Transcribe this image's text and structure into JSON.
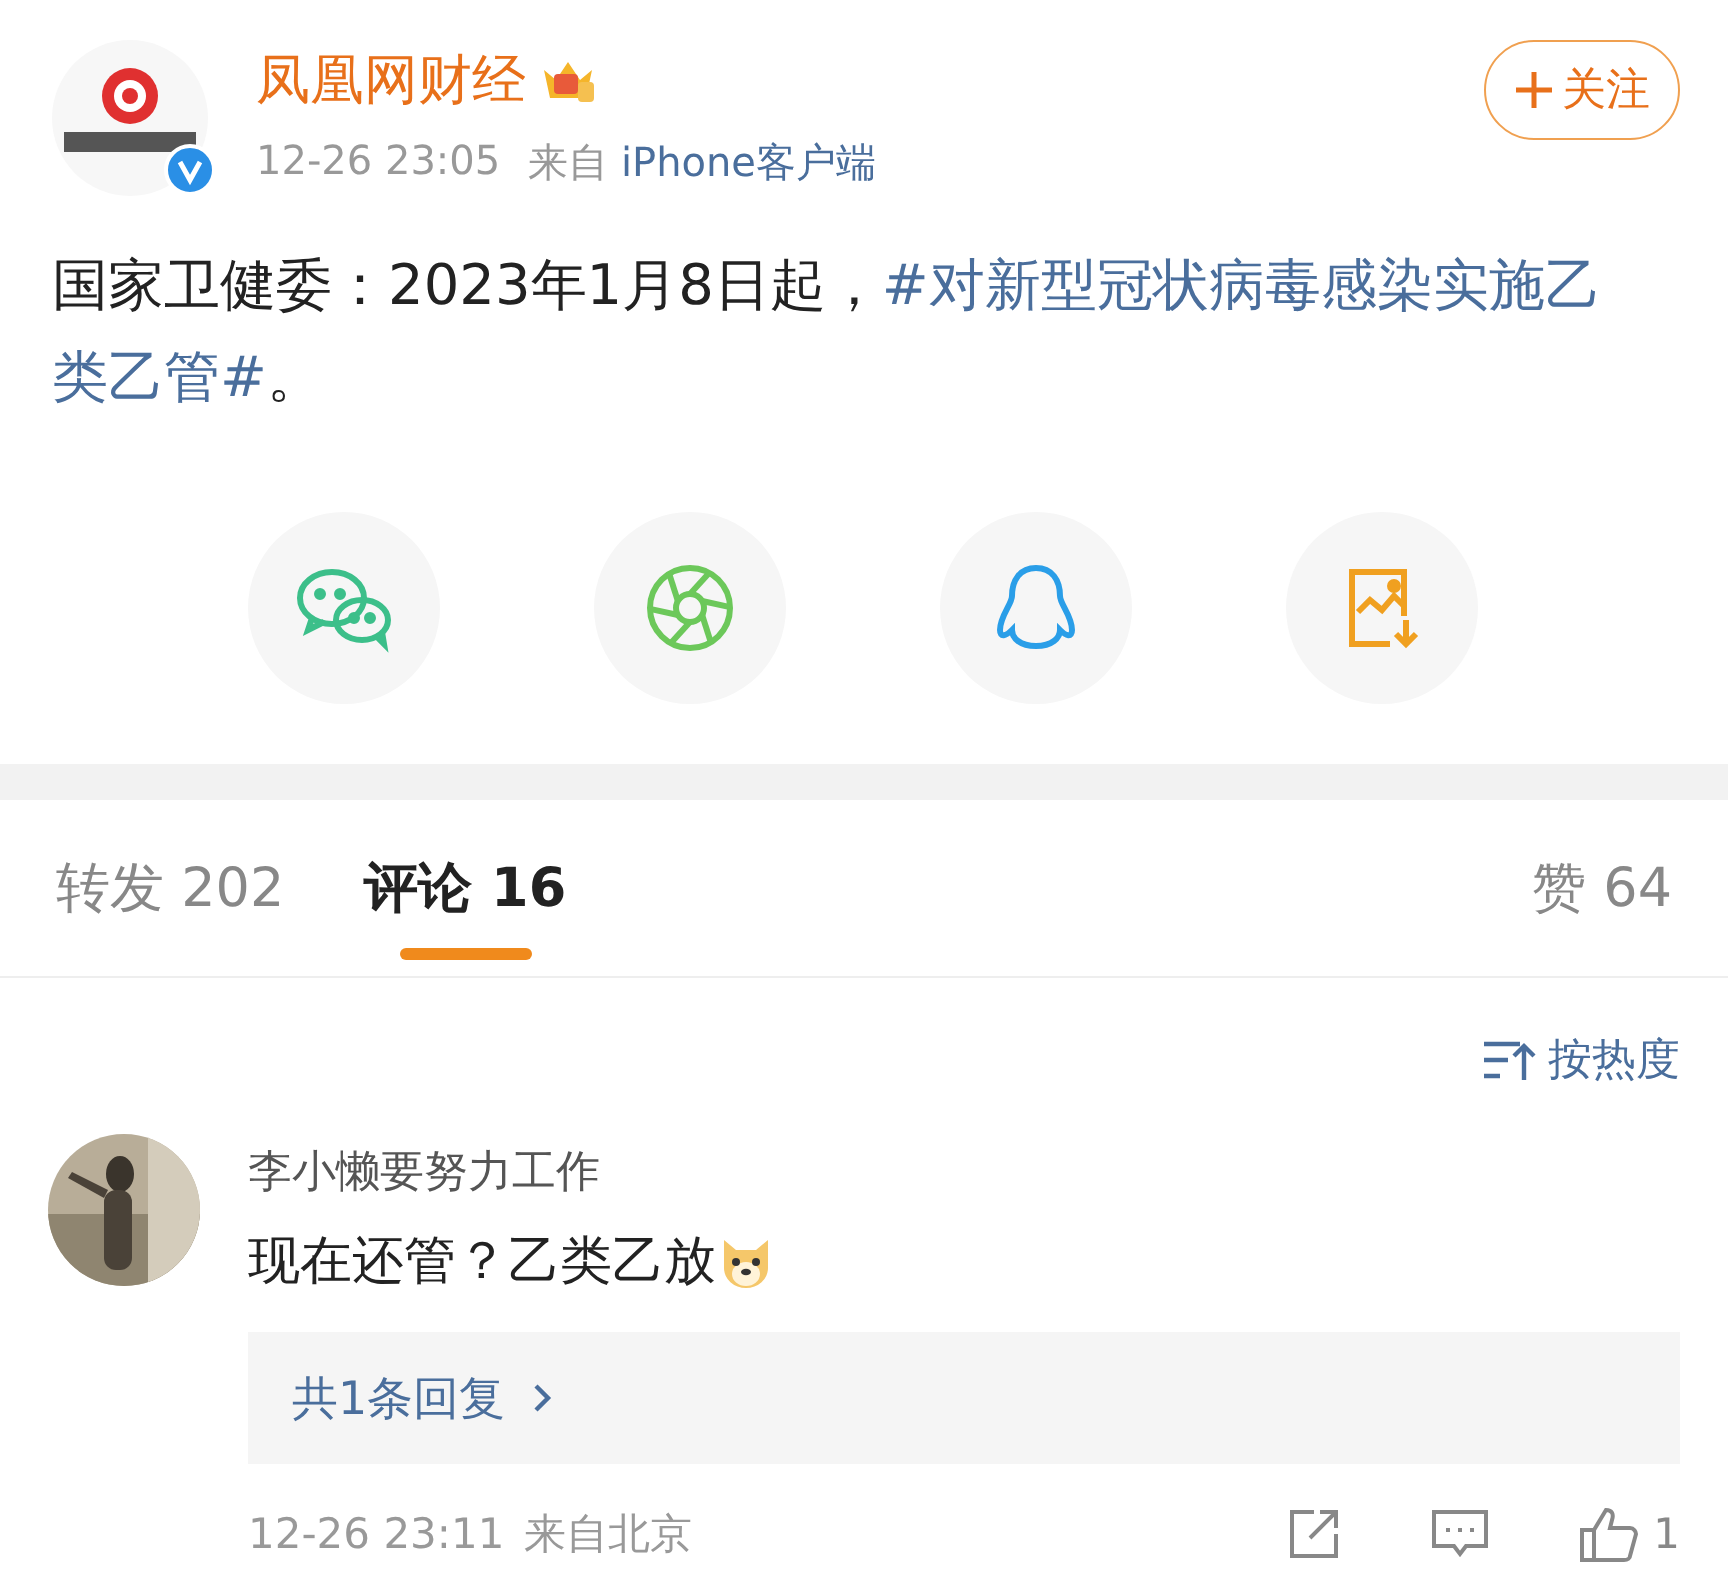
{
  "post": {
    "author": "凤凰网财经",
    "follow": "关注",
    "time": "12-26 23:05",
    "source_prefix": "来自",
    "source": "iPhone客户端",
    "verified": true,
    "segments": [
      {
        "kind": "plain",
        "text": "国家卫健委：2023年1月8日起，"
      },
      {
        "kind": "topic",
        "text": "#对新型冠状病毒感染实施乙类乙管#"
      },
      {
        "kind": "plain",
        "text": "。"
      }
    ]
  },
  "share": [
    {
      "kind": "wechat"
    },
    {
      "kind": "moments"
    },
    {
      "kind": "qq"
    },
    {
      "kind": "save"
    }
  ],
  "tabs": [
    {
      "label": "转发",
      "count": "202",
      "selected": false
    },
    {
      "label": "评论",
      "count": "16",
      "selected": true
    },
    {
      "label": "赞",
      "count": "64",
      "selected": false
    }
  ],
  "sort": "按热度",
  "comments": [
    {
      "user": "李小懒要努力工作",
      "text": "现在还管？乙类乙放",
      "replies": "共1条回复",
      "time": "12-26 23:11",
      "location": "来自北京",
      "likes": "1"
    }
  ]
}
